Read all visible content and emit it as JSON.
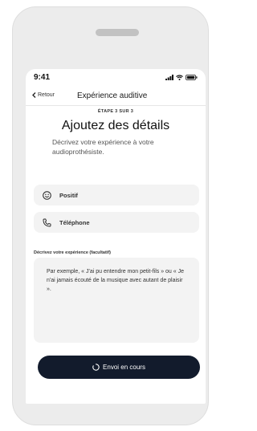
{
  "status_bar": {
    "time": "9:41",
    "icons": [
      "signal-icon",
      "wifi-icon",
      "battery-icon"
    ]
  },
  "nav": {
    "back_label": "Retour",
    "title": "Expérience auditive"
  },
  "step_label": "ÉTAPE 3 SUR 3",
  "heading": "Ajoutez des détails",
  "description": "Décrivez votre expérience à votre audioprothésiste.",
  "fields": [
    {
      "icon": "smiley-icon",
      "label": "Positif"
    },
    {
      "icon": "phone-icon",
      "label": "Téléphone"
    }
  ],
  "comment": {
    "label": "Décrivez votre expérience (facultatif)",
    "placeholder": "Par exemple, « J'ai pu entendre mon petit-fils » ou « Je n'ai jamais écouté de la musique avec autant de plaisir »."
  },
  "send_button": {
    "label": "Envoi en cours",
    "icon": "spinner-icon"
  },
  "colors": {
    "button_bg": "#121b2c",
    "field_bg": "#f3f3f3",
    "device_frame": "#ececec"
  }
}
